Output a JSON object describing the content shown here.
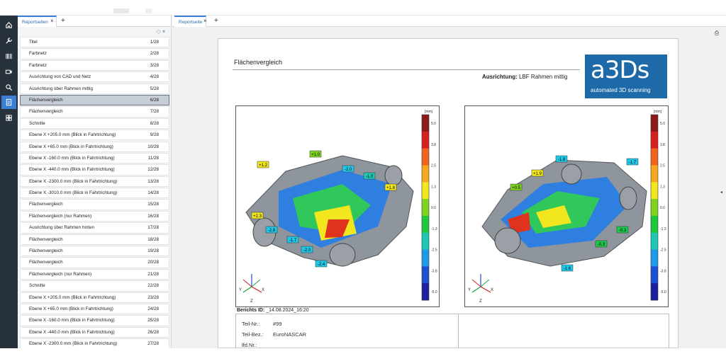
{
  "left_panel": {
    "tab_label": "Reportseiten",
    "tab_close": "×",
    "tab_add": "+",
    "pages": [
      {
        "label": "Titel",
        "num": "1/28"
      },
      {
        "label": "Farbnetz",
        "num": "2/28"
      },
      {
        "label": "Farbnetz",
        "num": "3/28"
      },
      {
        "label": "Ausrichtung von CAD und Netz",
        "num": "4/28"
      },
      {
        "label": "Ausrichtung über Rahmen mittig",
        "num": "5/28"
      },
      {
        "label": "Flächenvergleich",
        "num": "6/28"
      },
      {
        "label": "Flächenvergleich",
        "num": "7/28"
      },
      {
        "label": "Schnitte",
        "num": "8/28"
      },
      {
        "label": "Ebene X +205.0 mm  (Blick in Fahrtrichtung)",
        "num": "9/28"
      },
      {
        "label": "Ebene X +65.0 mm  (Blick in Fahrtrichtung)",
        "num": "10/28"
      },
      {
        "label": "Ebene X -160.0 mm  (Blick in Fahrtrichtung)",
        "num": "11/28"
      },
      {
        "label": "Ebene X -440.0 mm  (Blick in Fahrtrichtung)",
        "num": "12/28"
      },
      {
        "label": "Ebene X -2300.0 mm  (Blick in Fahrtrichtung)",
        "num": "13/28"
      },
      {
        "label": "Ebene X -3010.0 mm  (Blick in Fahrtrichtung)",
        "num": "14/28"
      },
      {
        "label": "Flächenvergleich",
        "num": "15/28"
      },
      {
        "label": "Flächenvergleich (nur Rahmen)",
        "num": "16/28"
      },
      {
        "label": "Ausrichtung über Rahmen hinten",
        "num": "17/28"
      },
      {
        "label": "Flächenvergleich",
        "num": "18/28"
      },
      {
        "label": "Flächenvergleich",
        "num": "19/28"
      },
      {
        "label": "Flächenvergleich",
        "num": "20/28"
      },
      {
        "label": "Flächenvergleich (nur Rahmen)",
        "num": "21/28"
      },
      {
        "label": "Schnitte",
        "num": "22/28"
      },
      {
        "label": "Ebene X +205.0 mm  (Blick in Fahrtrichtung)",
        "num": "23/28"
      },
      {
        "label": "Ebene X +65.0 mm  (Blick in Fahrtrichtung)",
        "num": "24/28"
      },
      {
        "label": "Ebene X -160.0 mm  (Blick in Fahrtrichtung)",
        "num": "25/28"
      },
      {
        "label": "Ebene X -440.0 mm  (Blick in Fahrtrichtung)",
        "num": "26/28"
      },
      {
        "label": "Ebene X -2300.0 mm  (Blick in Fahrtrichtung)",
        "num": "27/28"
      }
    ],
    "selected_page": "6/28"
  },
  "main": {
    "tab_label": "Reportseite",
    "tab_close": "×",
    "tab_add": "+",
    "page_title": "Flächenvergleich",
    "ausrichtung_label": "Ausrichtung:",
    "ausrichtung_value": "LBF Rahmen mittig",
    "logo_text": "a3Ds",
    "logo_tagline": "automated 3D scanning",
    "berichts_label": "Berichts ID:",
    "berichts_value": "_14.08.2024_16:20",
    "info": [
      {
        "label": "Teil-Nr.:",
        "value": "#99"
      },
      {
        "label": "Teil-Bez.:",
        "value": "EuroNASCAR"
      },
      {
        "label": "lfd.Nr.:",
        "value": ""
      }
    ]
  },
  "colorbar": {
    "unit": "[mm]",
    "ticks": [
      "5.0",
      "3.8",
      "2.5",
      "1.3",
      "0.0",
      "-1.3",
      "-2.5",
      "-3.8",
      "-5.0"
    ],
    "colors": [
      "#8b1a1a",
      "#d8201e",
      "#f0641e",
      "#f5a81e",
      "#f2e61e",
      "#7ed321",
      "#1ec83c",
      "#1ec8b4",
      "#1e9be6",
      "#1e50d2",
      "#1e1ea0"
    ]
  },
  "views": [
    {
      "labels": [
        {
          "text": "+1.2",
          "color": "#f2e61e"
        },
        {
          "text": "+1.0",
          "color": "#7ed321"
        },
        {
          "text": "-2.0",
          "color": "#1ec8e6"
        },
        {
          "text": "-1.0",
          "color": "#1ec8b4"
        },
        {
          "text": "+1.8",
          "color": "#f2e61e"
        },
        {
          "text": "+2.3",
          "color": "#f2e61e"
        },
        {
          "text": "-2.8",
          "color": "#1ec8e6"
        },
        {
          "text": "-1.7",
          "color": "#1ec8e6"
        },
        {
          "text": "-2.0",
          "color": "#1ec8e6"
        },
        {
          "text": "-2.4",
          "color": "#1ec8e6"
        }
      ]
    },
    {
      "labels": [
        {
          "text": "-1.8",
          "color": "#1ec8e6"
        },
        {
          "text": "-1.7",
          "color": "#1ec8e6"
        },
        {
          "text": "+1.9",
          "color": "#f2e61e"
        },
        {
          "text": "+0.5",
          "color": "#7ed321"
        },
        {
          "text": "-0.3",
          "color": "#1ec84e"
        },
        {
          "text": "-0.3",
          "color": "#1ec84e"
        },
        {
          "text": "-1.6",
          "color": "#1ec8e6"
        }
      ]
    }
  ],
  "axes": {
    "y": "Y",
    "x": "X",
    "z": "Z"
  },
  "icons": [
    "home-icon",
    "wrench-icon",
    "barcode-icon",
    "camera-icon",
    "search-icon",
    "report-icon",
    "grid-icon"
  ]
}
